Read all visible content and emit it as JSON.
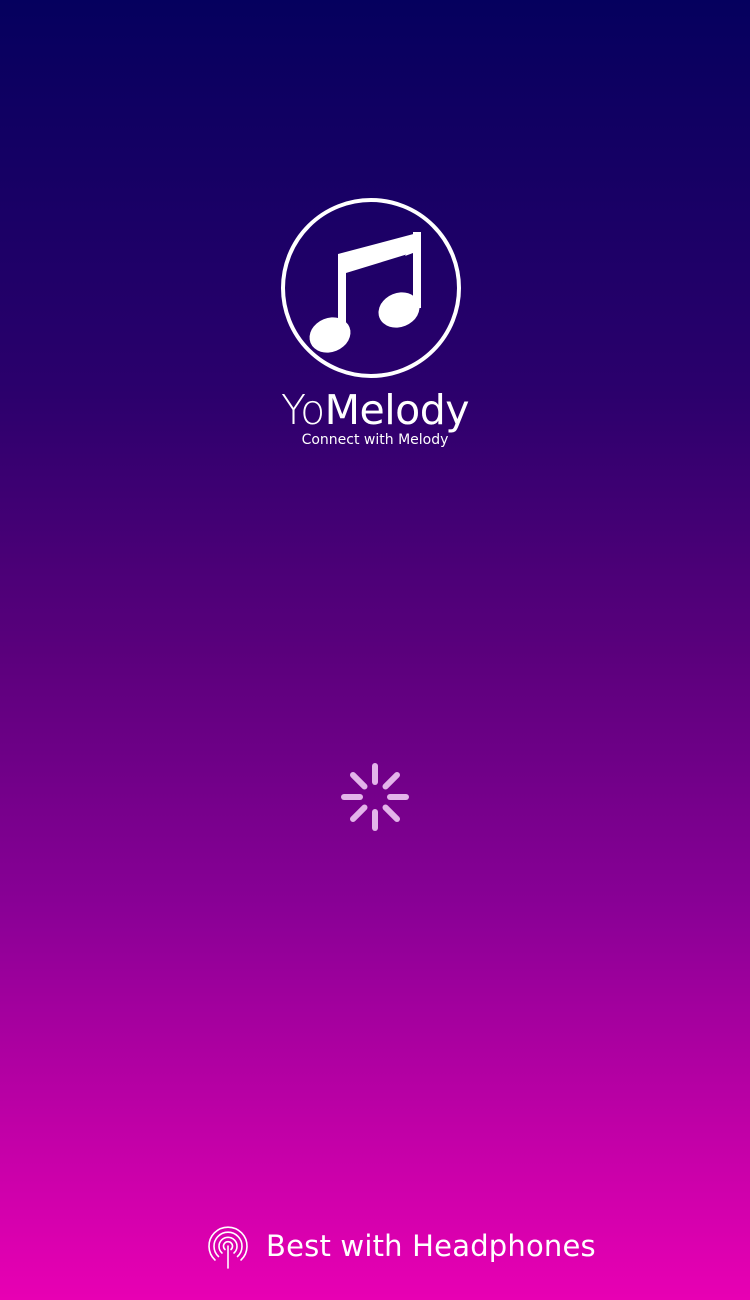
{
  "app": {
    "brand_prefix": "Yo",
    "brand_suffix": "Melody",
    "tagline": "Connect with Melody"
  },
  "icons": {
    "logo": "music-note-icon",
    "loading": "loading-spinner-icon",
    "footer": "headphones-broadcast-icon"
  },
  "footer": {
    "text": "Best with Headphones"
  },
  "colors": {
    "gradient_top": "#05005e",
    "gradient_bottom": "#e800b3",
    "foreground": "#ffffff"
  }
}
